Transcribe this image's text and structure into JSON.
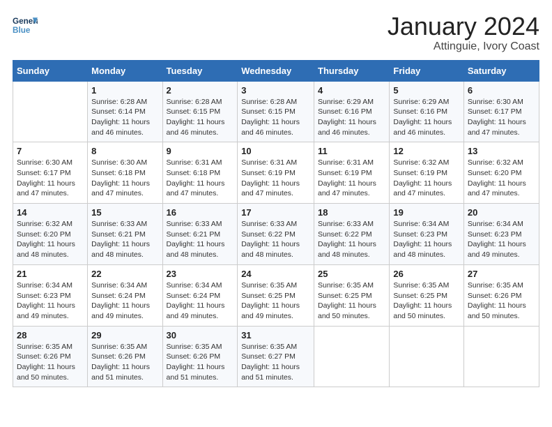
{
  "header": {
    "logo_line1": "General",
    "logo_line2": "Blue",
    "month": "January 2024",
    "location": "Attinguie, Ivory Coast"
  },
  "days_of_week": [
    "Sunday",
    "Monday",
    "Tuesday",
    "Wednesday",
    "Thursday",
    "Friday",
    "Saturday"
  ],
  "weeks": [
    [
      {
        "day": "",
        "info": ""
      },
      {
        "day": "1",
        "info": "Sunrise: 6:28 AM\nSunset: 6:14 PM\nDaylight: 11 hours and 46 minutes."
      },
      {
        "day": "2",
        "info": "Sunrise: 6:28 AM\nSunset: 6:15 PM\nDaylight: 11 hours and 46 minutes."
      },
      {
        "day": "3",
        "info": "Sunrise: 6:28 AM\nSunset: 6:15 PM\nDaylight: 11 hours and 46 minutes."
      },
      {
        "day": "4",
        "info": "Sunrise: 6:29 AM\nSunset: 6:16 PM\nDaylight: 11 hours and 46 minutes."
      },
      {
        "day": "5",
        "info": "Sunrise: 6:29 AM\nSunset: 6:16 PM\nDaylight: 11 hours and 46 minutes."
      },
      {
        "day": "6",
        "info": "Sunrise: 6:30 AM\nSunset: 6:17 PM\nDaylight: 11 hours and 47 minutes."
      }
    ],
    [
      {
        "day": "7",
        "info": "Sunrise: 6:30 AM\nSunset: 6:17 PM\nDaylight: 11 hours and 47 minutes."
      },
      {
        "day": "8",
        "info": "Sunrise: 6:30 AM\nSunset: 6:18 PM\nDaylight: 11 hours and 47 minutes."
      },
      {
        "day": "9",
        "info": "Sunrise: 6:31 AM\nSunset: 6:18 PM\nDaylight: 11 hours and 47 minutes."
      },
      {
        "day": "10",
        "info": "Sunrise: 6:31 AM\nSunset: 6:19 PM\nDaylight: 11 hours and 47 minutes."
      },
      {
        "day": "11",
        "info": "Sunrise: 6:31 AM\nSunset: 6:19 PM\nDaylight: 11 hours and 47 minutes."
      },
      {
        "day": "12",
        "info": "Sunrise: 6:32 AM\nSunset: 6:19 PM\nDaylight: 11 hours and 47 minutes."
      },
      {
        "day": "13",
        "info": "Sunrise: 6:32 AM\nSunset: 6:20 PM\nDaylight: 11 hours and 47 minutes."
      }
    ],
    [
      {
        "day": "14",
        "info": "Sunrise: 6:32 AM\nSunset: 6:20 PM\nDaylight: 11 hours and 48 minutes."
      },
      {
        "day": "15",
        "info": "Sunrise: 6:33 AM\nSunset: 6:21 PM\nDaylight: 11 hours and 48 minutes."
      },
      {
        "day": "16",
        "info": "Sunrise: 6:33 AM\nSunset: 6:21 PM\nDaylight: 11 hours and 48 minutes."
      },
      {
        "day": "17",
        "info": "Sunrise: 6:33 AM\nSunset: 6:22 PM\nDaylight: 11 hours and 48 minutes."
      },
      {
        "day": "18",
        "info": "Sunrise: 6:33 AM\nSunset: 6:22 PM\nDaylight: 11 hours and 48 minutes."
      },
      {
        "day": "19",
        "info": "Sunrise: 6:34 AM\nSunset: 6:23 PM\nDaylight: 11 hours and 48 minutes."
      },
      {
        "day": "20",
        "info": "Sunrise: 6:34 AM\nSunset: 6:23 PM\nDaylight: 11 hours and 49 minutes."
      }
    ],
    [
      {
        "day": "21",
        "info": "Sunrise: 6:34 AM\nSunset: 6:23 PM\nDaylight: 11 hours and 49 minutes."
      },
      {
        "day": "22",
        "info": "Sunrise: 6:34 AM\nSunset: 6:24 PM\nDaylight: 11 hours and 49 minutes."
      },
      {
        "day": "23",
        "info": "Sunrise: 6:34 AM\nSunset: 6:24 PM\nDaylight: 11 hours and 49 minutes."
      },
      {
        "day": "24",
        "info": "Sunrise: 6:35 AM\nSunset: 6:25 PM\nDaylight: 11 hours and 49 minutes."
      },
      {
        "day": "25",
        "info": "Sunrise: 6:35 AM\nSunset: 6:25 PM\nDaylight: 11 hours and 50 minutes."
      },
      {
        "day": "26",
        "info": "Sunrise: 6:35 AM\nSunset: 6:25 PM\nDaylight: 11 hours and 50 minutes."
      },
      {
        "day": "27",
        "info": "Sunrise: 6:35 AM\nSunset: 6:26 PM\nDaylight: 11 hours and 50 minutes."
      }
    ],
    [
      {
        "day": "28",
        "info": "Sunrise: 6:35 AM\nSunset: 6:26 PM\nDaylight: 11 hours and 50 minutes."
      },
      {
        "day": "29",
        "info": "Sunrise: 6:35 AM\nSunset: 6:26 PM\nDaylight: 11 hours and 51 minutes."
      },
      {
        "day": "30",
        "info": "Sunrise: 6:35 AM\nSunset: 6:26 PM\nDaylight: 11 hours and 51 minutes."
      },
      {
        "day": "31",
        "info": "Sunrise: 6:35 AM\nSunset: 6:27 PM\nDaylight: 11 hours and 51 minutes."
      },
      {
        "day": "",
        "info": ""
      },
      {
        "day": "",
        "info": ""
      },
      {
        "day": "",
        "info": ""
      }
    ]
  ]
}
